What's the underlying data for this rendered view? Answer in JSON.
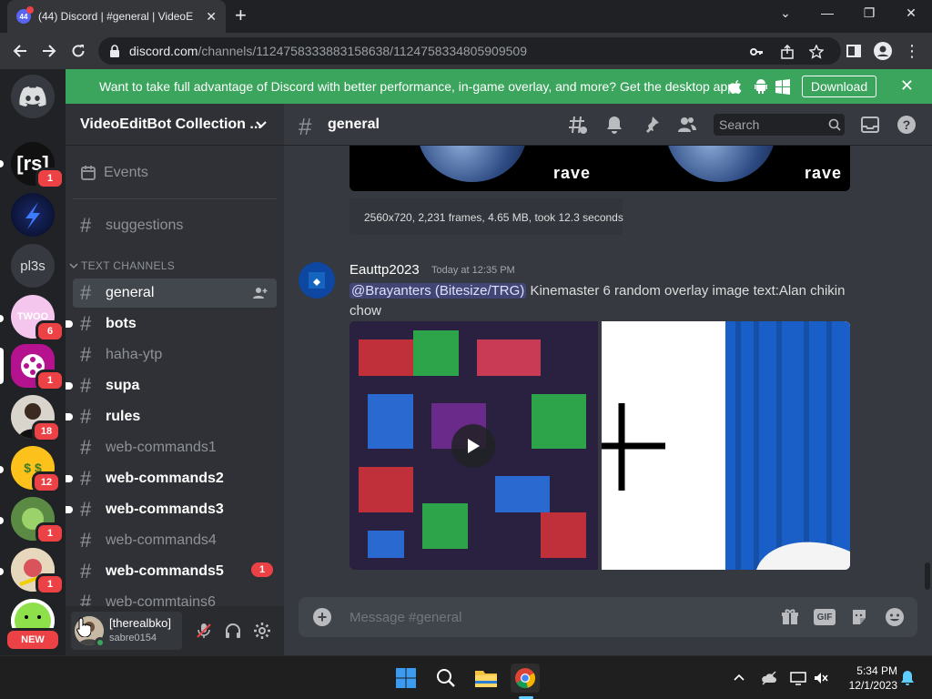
{
  "browser": {
    "tab_title": "(44) Discord | #general | VideoEd",
    "favicon_badge": "44",
    "url_host": "discord.com",
    "url_path": "/channels/1124758333883158638/1124758334805909509"
  },
  "banner": {
    "text": "Want to take full advantage of Discord with better performance, in-game overlay, and more? Get the desktop app!",
    "download_label": "Download"
  },
  "guilds": [
    {
      "label": "[rs]",
      "badge": "1"
    },
    {
      "label": "",
      "badge": ""
    },
    {
      "label": "pl3s",
      "badge": ""
    },
    {
      "label": "TWOO",
      "badge": "6"
    },
    {
      "label": "",
      "badge": "1"
    },
    {
      "label": "",
      "badge": "18"
    },
    {
      "label": "$ $",
      "badge": "12"
    },
    {
      "label": "",
      "badge": "1"
    },
    {
      "label": "",
      "badge": "1"
    },
    {
      "label": "",
      "badge": "NEW"
    }
  ],
  "server": {
    "name": "VideoEditBot Collection ...",
    "events_label": "Events",
    "category": "TEXT CHANNELS"
  },
  "channels": [
    {
      "name": "suggestions"
    },
    {
      "name": "general"
    },
    {
      "name": "bots"
    },
    {
      "name": "haha-ytp"
    },
    {
      "name": "supa"
    },
    {
      "name": "rules"
    },
    {
      "name": "web-commands1"
    },
    {
      "name": "web-commands2"
    },
    {
      "name": "web-commands3"
    },
    {
      "name": "web-commands4"
    },
    {
      "name": "web-commands5",
      "badge": "1"
    },
    {
      "name": "web-commtains6"
    }
  ],
  "user": {
    "display_name": "[therealbko]",
    "username": "sabre0154"
  },
  "chat": {
    "channel_name": "general",
    "search_placeholder": "Search",
    "embed_watermark": "rave",
    "video_info": "2560x720, 2,231 frames, 4.65 MB, took 12.3 seconds",
    "message": {
      "author": "Eauttp2023",
      "timestamp": "Today at 12:35 PM",
      "mention": "@Brayanters (Bitesize/TRG)",
      "text": "Kinemaster 6 random overlay image text:Alan chikin chow"
    },
    "composer_placeholder": "Message #general",
    "gif_label": "GIF"
  },
  "taskbar": {
    "time": "5:34 PM",
    "date": "12/1/2023"
  },
  "colors": {
    "discord_blurple": "#5865f2",
    "banner_green": "#3ba55d",
    "mention_bg": "#414675",
    "badge_red": "#ed4245"
  }
}
